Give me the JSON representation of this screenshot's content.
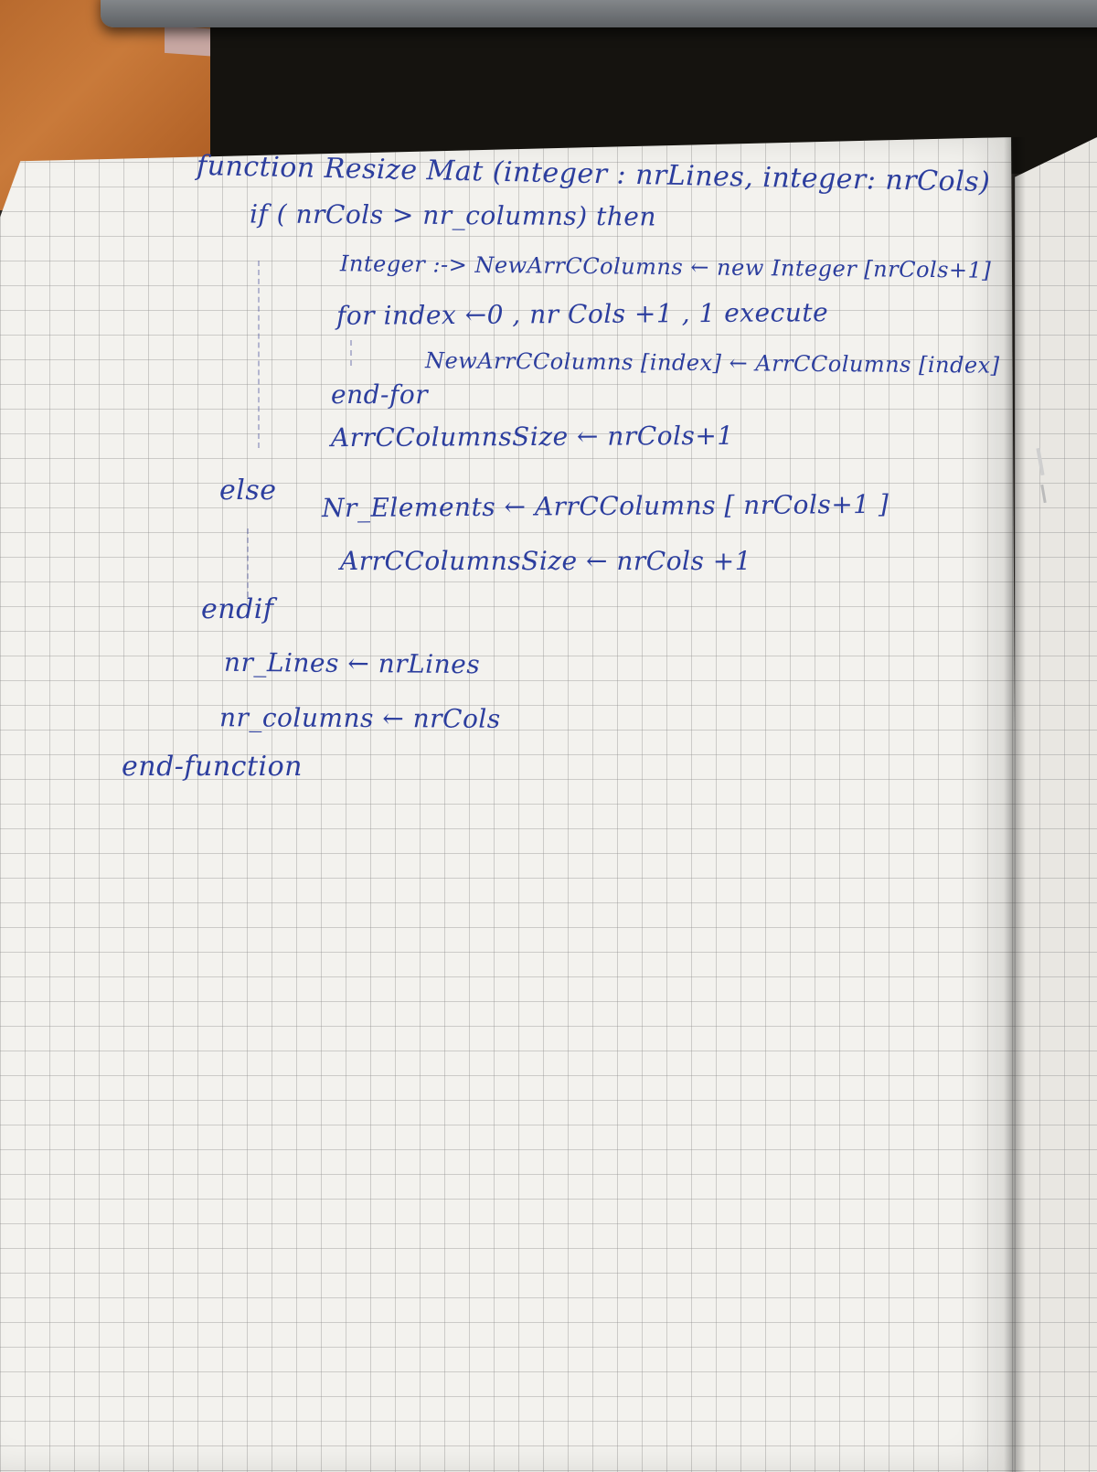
{
  "lines": {
    "l1": "function  Resize Mat (integer : nrLines, integer: nrCols)",
    "l2": "if  ( nrCols > nr_columns)  then",
    "l3": "Integer :->  NewArrCColumns ← new Integer [nrCols+1]",
    "l4": "for index ←0 , nr Cols +1 , 1  execute",
    "l5": "NewArrCColumns [index] ← ArrCColumns [index]",
    "l6": "end-for",
    "l7": "ArrCColumnsSize ← nrCols+1",
    "l8": "else",
    "l9": "Nr_Elements ← ArrCColumns [ nrCols+1 ]",
    "l10": "ArrCColumnsSize ← nrCols +1",
    "l11": "endif",
    "l12": "nr_Lines ← nrLines",
    "l13": "nr_columns ← nrCols",
    "l14": "end-function"
  }
}
